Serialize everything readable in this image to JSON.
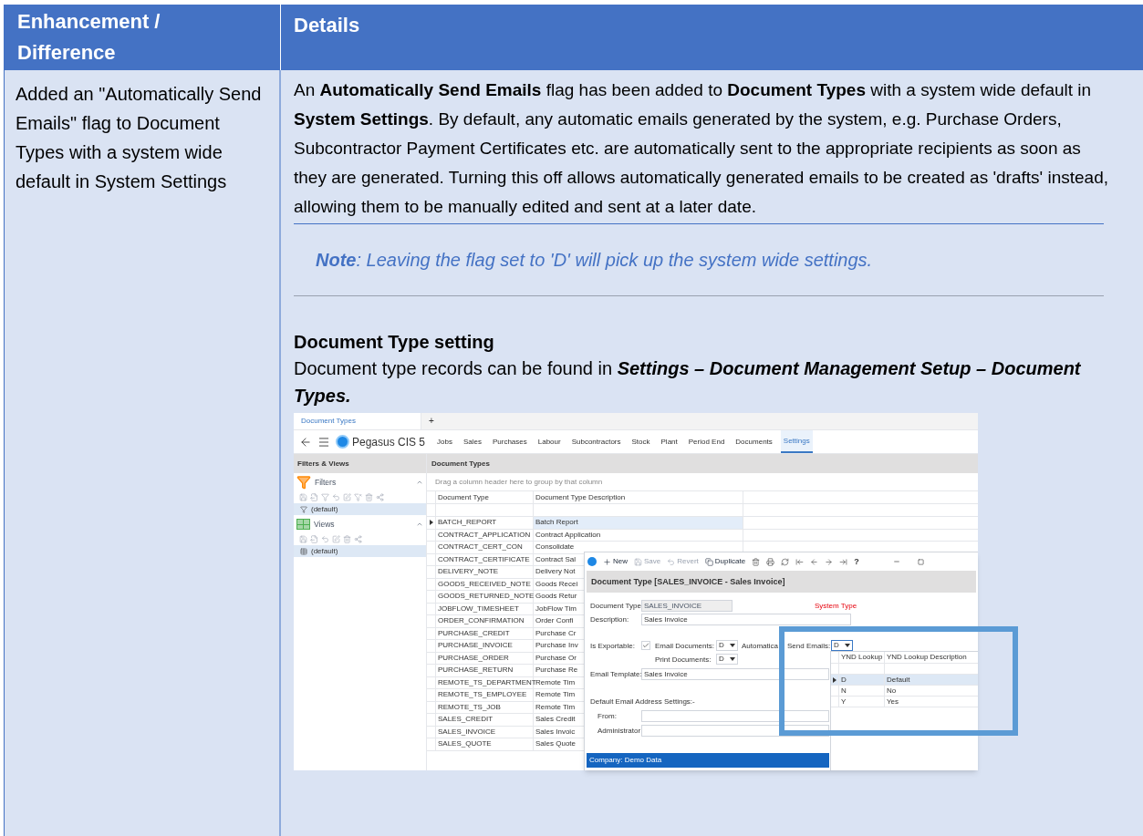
{
  "table": {
    "columns": [
      "Enhancement / Difference",
      "Details"
    ],
    "rows": [
      {
        "enhancement": "Added an \"Automatically Send Emails\" flag to Document Types with a system wide default in System Settings",
        "details": {
          "paragraph": "An **Automatically Send Emails** flag has been added to **Document Types** with a system wide default in **System Settings**.  By default, any automatic emails generated by the system, e.g. Purchase Orders, Subcontractor Payment Certificates etc. are automatically sent to the appropriate recipients as soon as they are generated. Turning this off allows automatically generated emails to be created as 'drafts' instead, allowing them to be manually edited and sent at a later date.",
          "note": "**Note**: Leaving the flag set to 'D' will pick up the system wide settings.",
          "heading": "Document Type setting",
          "location": "Document type records can be found in **Settings – Document Management Setup – Document Types.**",
          "screenshot": {
            "tabs": [
              {
                "label": "Document Types",
                "selected": true
              }
            ],
            "new_tab": "+",
            "app_name": "Pegasus CIS 5",
            "menu": [
              {
                "label": "Jobs",
                "selected": false
              },
              {
                "label": "Sales",
                "selected": false
              },
              {
                "label": "Purchases",
                "selected": false
              },
              {
                "label": "Labour",
                "selected": false
              },
              {
                "label": "Subcontractors",
                "selected": false
              },
              {
                "label": "Stock",
                "selected": false
              },
              {
                "label": "Plant",
                "selected": false
              },
              {
                "label": "Period End",
                "selected": false
              },
              {
                "label": "Documents",
                "selected": false
              },
              {
                "label": "Settings",
                "selected": true
              }
            ],
            "left_pane": {
              "title": "Filters & Views",
              "sections": [
                {
                  "kind": "filters",
                  "title": "Filters",
                  "items": [
                    {
                      "label": "(default)",
                      "selected": true
                    }
                  ]
                },
                {
                  "kind": "views",
                  "title": "Views",
                  "items": [
                    {
                      "label": "(default)",
                      "selected": true
                    }
                  ]
                }
              ]
            },
            "grid": {
              "title": "Document Types",
              "group_hint": "Drag a column header here to group by that column",
              "columns": [
                "Document Type",
                "Document Type Description"
              ],
              "rows": [
                {
                  "type": "BATCH_REPORT",
                  "description": "Batch Report",
                  "selected": true
                },
                {
                  "type": "CONTRACT_APPLICATION",
                  "description": "Contract Application",
                  "selected": false
                },
                {
                  "type": "CONTRACT_CERT_CON",
                  "description": "Consolidate",
                  "selected": false
                },
                {
                  "type": "CONTRACT_CERTIFICATE",
                  "description": "Contract Sal",
                  "selected": false
                },
                {
                  "type": "DELIVERY_NOTE",
                  "description": "Delivery Not",
                  "selected": false
                },
                {
                  "type": "GOODS_RECEIVED_NOTE",
                  "description": "Goods Recei",
                  "selected": false
                },
                {
                  "type": "GOODS_RETURNED_NOTE",
                  "description": "Goods Retur",
                  "selected": false
                },
                {
                  "type": "JOBFLOW_TIMESHEET",
                  "description": "JobFlow Tim",
                  "selected": false
                },
                {
                  "type": "ORDER_CONFIRMATION",
                  "description": "Order Confi",
                  "selected": false
                },
                {
                  "type": "PURCHASE_CREDIT",
                  "description": "Purchase Cr",
                  "selected": false
                },
                {
                  "type": "PURCHASE_INVOICE",
                  "description": "Purchase Inv",
                  "selected": false
                },
                {
                  "type": "PURCHASE_ORDER",
                  "description": "Purchase Or",
                  "selected": false
                },
                {
                  "type": "PURCHASE_RETURN",
                  "description": "Purchase Re",
                  "selected": false
                },
                {
                  "type": "REMOTE_TS_DEPARTMENT",
                  "description": "Remote Tim",
                  "selected": false
                },
                {
                  "type": "REMOTE_TS_EMPLOYEE",
                  "description": "Remote Tim",
                  "selected": false
                },
                {
                  "type": "REMOTE_TS_JOB",
                  "description": "Remote Tim",
                  "selected": false
                },
                {
                  "type": "SALES_CREDIT",
                  "description": "Sales Credit",
                  "selected": false
                },
                {
                  "type": "SALES_INVOICE",
                  "description": "Sales Invoic",
                  "selected": false
                },
                {
                  "type": "SALES_QUOTE",
                  "description": "Sales Quote",
                  "selected": false
                }
              ]
            },
            "dialog": {
              "toolbar": [
                {
                  "label": "New",
                  "disabled": false
                },
                {
                  "label": "Save",
                  "disabled": true
                },
                {
                  "label": "Revert",
                  "disabled": true
                },
                {
                  "label": "Duplicate",
                  "disabled": false
                }
              ],
              "help": "?",
              "title": "Document Type [SALES_INVOICE - Sales Invoice]",
              "document_type": {
                "label": "Document Type:",
                "value": "SALES_INVOICE"
              },
              "system_type": "System Type",
              "description": {
                "label": "Description:",
                "value": "Sales Invoice"
              },
              "is_exportable": {
                "label": "Is Exportable:",
                "checked": true
              },
              "email_documents": {
                "label": "Email Documents:",
                "value": "D"
              },
              "print_documents": {
                "label": "Print Documents:",
                "value": "D"
              },
              "auto_send_label": "Automatica",
              "send_emails": {
                "label": "Send Emails:",
                "value": "D"
              },
              "email_template": {
                "label": "Email Template:",
                "value": "Sales Invoice"
              },
              "address_heading": "Default Email Address Settings:-",
              "from": {
                "label": "From:"
              },
              "administrator": {
                "label": "Administrator:"
              },
              "status": "Company:  Demo Data"
            },
            "lookup": {
              "columns": [
                "YND Lookup",
                "YND Lookup Description"
              ],
              "rows": [
                {
                  "code": "D",
                  "description": "Default",
                  "selected": true
                },
                {
                  "code": "N",
                  "description": "No",
                  "selected": false
                },
                {
                  "code": "Y",
                  "description": "Yes",
                  "selected": false
                }
              ]
            }
          }
        }
      }
    ]
  }
}
